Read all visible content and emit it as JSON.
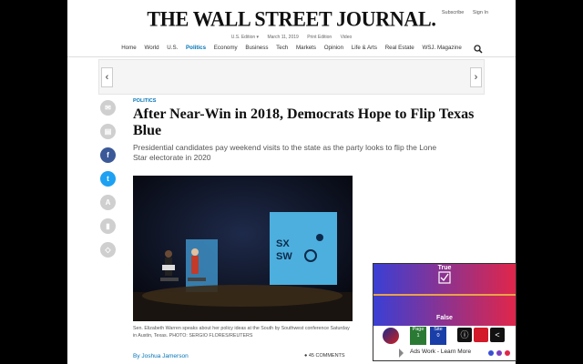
{
  "topright": {
    "subscribe": "Subscribe",
    "signin": "Sign In"
  },
  "masthead": "THE WALL STREET JOURNAL.",
  "subbar": {
    "edition": "U.S. Edition ▾",
    "date": "March 11, 2019",
    "print": "Print Edition",
    "video": "Video"
  },
  "nav": [
    "Home",
    "World",
    "U.S.",
    "Politics",
    "Economy",
    "Business",
    "Tech",
    "Markets",
    "Opinion",
    "Life & Arts",
    "Real Estate",
    "WSJ. Magazine"
  ],
  "ad": {
    "prev": "‹",
    "next": "›"
  },
  "article": {
    "section": "POLITICS",
    "headline": "After Near-Win in 2018, Democrats Hope to Flip Texas Blue",
    "dek": "Presidential candidates pay weekend visits to the state as the party looks to flip the Lone Star electorate in 2020",
    "caption": "Sen. Elizabeth Warren speaks about her policy ideas at the South by Southwest conference Saturday in Austin, Texas.",
    "credit": "PHOTO: SERGIO FLORES/REUTERS",
    "byline": "By Joshua Jamerson",
    "comments": "45 COMMENTS"
  },
  "widget": {
    "true_label": "True",
    "false_label": "False",
    "page_label": "Page",
    "page_num": "1",
    "site_label": "Site",
    "site_num": "0",
    "footer": "Ads Work - Learn More",
    "dot_colors": [
      "#3a4fd4",
      "#7a3fc0",
      "#e0264a"
    ]
  }
}
